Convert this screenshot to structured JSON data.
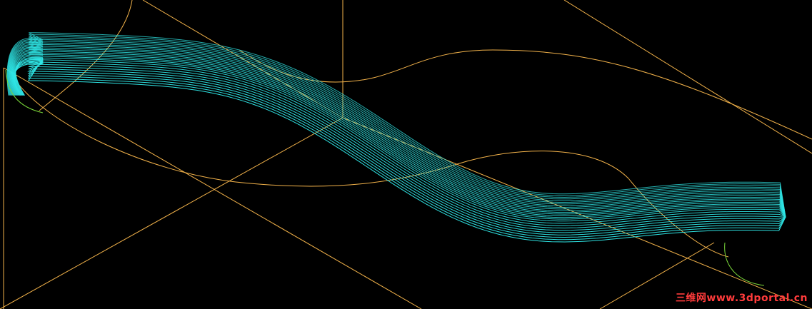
{
  "viewport": {
    "background_color": "#000000",
    "colors": {
      "construction_lines": "#f2b24a",
      "toolpath": "#2fe6e6",
      "profile_arcs": "#7ad83a"
    }
  },
  "watermark": {
    "text": "三维网www.3dportal.cn",
    "color": "#ff3b3b"
  }
}
